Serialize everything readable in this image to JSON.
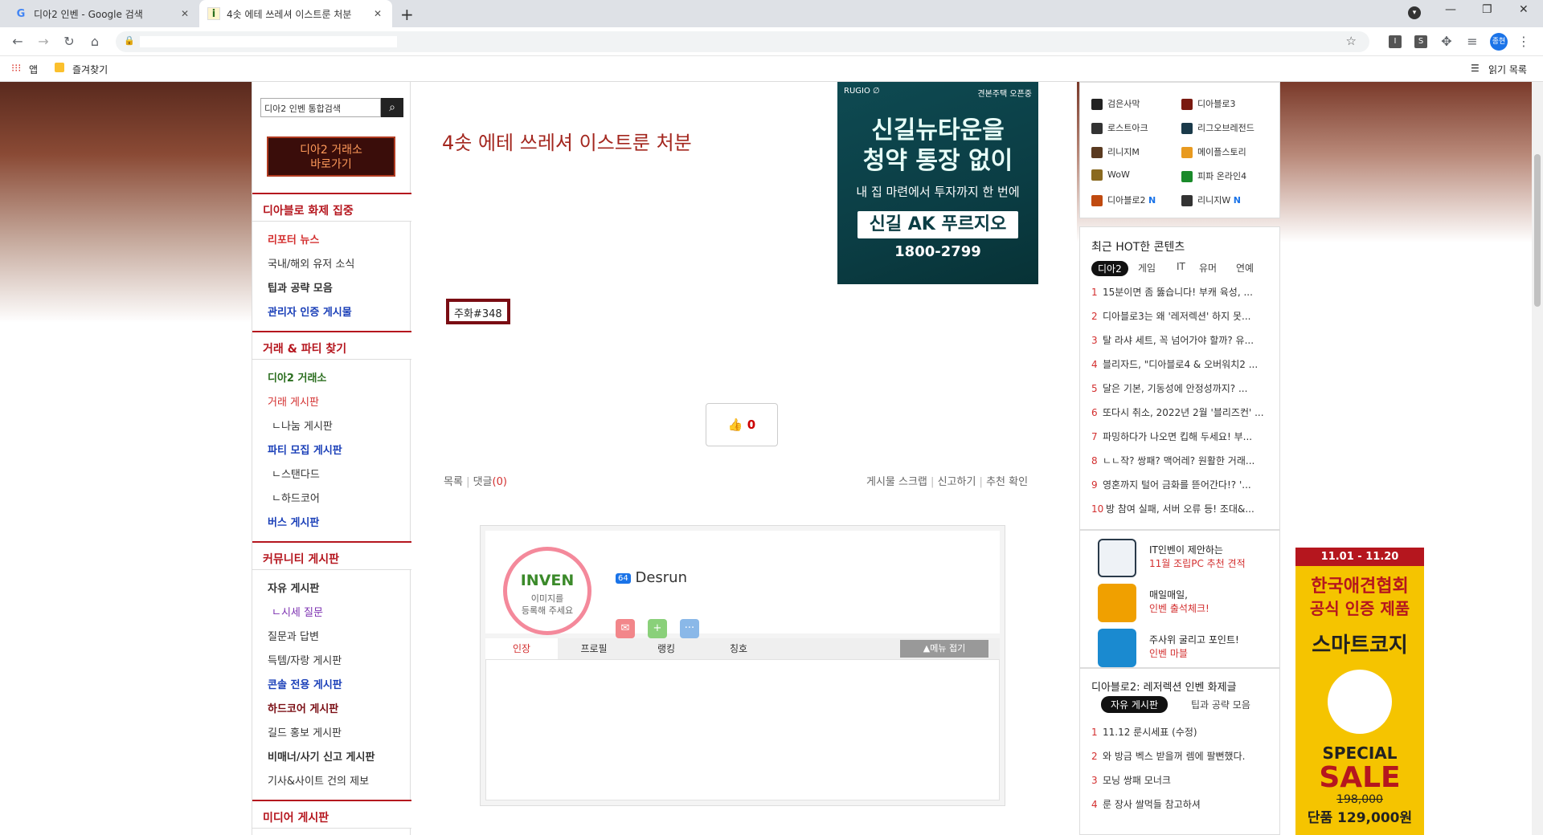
{
  "browser": {
    "tabs": [
      {
        "title": "디아2 인벤 - Google 검색",
        "favicon": "G"
      },
      {
        "title": "4솟 에테 쓰레셔 이스트룬 처분",
        "favicon": "i"
      }
    ],
    "new_tab": "+",
    "bookmarks": {
      "apps": "앱",
      "favorites": "즐겨찾기",
      "reading_list": "읽기 목록"
    },
    "profile_initials": "종현"
  },
  "sidebar": {
    "search_placeholder": "디아2 인벤 통합검색",
    "banner": {
      "line1": "디아2 거래소",
      "line2": "바로가기"
    },
    "sections": [
      {
        "title": "디아블로 화제 집중",
        "items": [
          "리포터 뉴스",
          "국내/해외 유저 소식",
          "팁과 공략 모음",
          "관리자 인증 게시물"
        ]
      },
      {
        "title": "거래 & 파티 찾기",
        "items": [
          "디아2 거래소",
          "거래 게시판",
          "ㄴ나눔 게시판",
          "파티 모집 게시판",
          "ㄴ스탠다드",
          "ㄴ하드코어",
          "버스 게시판"
        ]
      },
      {
        "title": "커뮤니티 게시판",
        "items": [
          "자유 게시판",
          "ㄴ시세 질문",
          "질문과 답변",
          "득템/자랑 게시판",
          "콘솔 전용 게시판",
          "하드코어 게시판",
          "길드 홍보 게시판",
          "비매너/사기 신고 게시판",
          "기사&사이트 건의 제보"
        ]
      },
      {
        "title": "미디어 게시판",
        "items": []
      }
    ]
  },
  "article": {
    "title": "4솟 에테 쓰레셔 이스트룬 처분",
    "tag": "주화#348",
    "likes": "0",
    "nav_left": {
      "list": "목록",
      "comments": "댓글",
      "comment_count": "(0)"
    },
    "nav_right": [
      "게시물 스크랩",
      "신고하기",
      "추천 확인"
    ]
  },
  "ad_top": {
    "brand": "RUGIO ∅",
    "corner": "견본주택 오픈중",
    "headline1": "신길뉴타운을",
    "headline2": "청약 통장 없이",
    "sub": "내 집 마련에서 투자까지 한 번에",
    "name": "신길 AK 푸르지오",
    "tel": "1800-2799"
  },
  "profile": {
    "logo": "INVEN",
    "avatar_text1": "이미지를",
    "avatar_text2": "등록해 주세요",
    "level": "64",
    "username": "Desrun",
    "tabs": [
      "인장",
      "프로필",
      "랭킹",
      "칭호"
    ],
    "fold": "▲메뉴 접기"
  },
  "games": [
    {
      "name": "검은사막",
      "color": "#222"
    },
    {
      "name": "디아블로3",
      "color": "#7a1a10"
    },
    {
      "name": "로스트아크",
      "color": "#333"
    },
    {
      "name": "리그오브레전드",
      "color": "#1a3a4a"
    },
    {
      "name": "리니지M",
      "color": "#5a3a20"
    },
    {
      "name": "메이플스토리",
      "color": "#e89a20"
    },
    {
      "name": "WoW",
      "color": "#8a6a20"
    },
    {
      "name": "피파 온라인4",
      "color": "#1a8a2a"
    },
    {
      "name": "디아블로2",
      "badge": "N",
      "color": "#c04a10"
    },
    {
      "name": "리니지W",
      "badge": "N",
      "color": "#333"
    }
  ],
  "hot": {
    "title": "최근 HOT한 콘텐츠",
    "tabs": [
      "디아2",
      "게임",
      "IT",
      "유머",
      "연예"
    ],
    "items": [
      "15분이면 좀 뚫습니다! 부캐 육성, ...",
      "디아블로3는 왜 '레저렉션' 하지 못...",
      "탈 라샤 세트, 꼭 넘어가야 할까? 유...",
      "블리자드, \"디아블로4 & 오버워치2 ...",
      "달은 기본, 기동성에 안정성까지? ...",
      "또다시 취소, 2022년 2월 '블리즈컨' ...",
      "파밍하다가 나오면 킵해 두세요! 부...",
      "ㄴㄴ작? 쌍패? 맥어레? 원활한 거래...",
      "영혼까지 털어 금화를 뜯어간다!? '...",
      "방 참여 실패, 서버 오류 등! 조대&..."
    ]
  },
  "promos": [
    {
      "line1": "IT인벤이 제안하는",
      "line2": "11월 조립PC 추천 견적",
      "icon": "monitor-icon",
      "color": "#2a3a4a"
    },
    {
      "line1": "매일매일,",
      "line2": "인벤 출석체크!",
      "icon": "calendar-icon",
      "color": "#f0a000"
    },
    {
      "line1": "주사위 굴리고 포인트!",
      "line2": "인벤 마블",
      "icon": "dice-icon",
      "color": "#1a8ad0"
    }
  ],
  "d2": {
    "title": "디아블로2: 레저렉션 인벤 화제글",
    "tabs": [
      "자유 게시판",
      "팁과 공략 모음"
    ],
    "items": [
      "11.12 룬시세표 (수정)",
      "와 방금 벡스 받을꺼 렘에 팔뻔했다.",
      "모닝 쌍패 모너크",
      "룬 장사 쌀먹들 참고하셔"
    ]
  },
  "ad_side": {
    "date": "11.01 - 11.20",
    "line1": "한국애견협회",
    "line2": "공식 인증 제품",
    "brand": "스마트코지",
    "special": "SPECIAL",
    "sale": "SALE",
    "old_price": "198,000",
    "price": "단품 129,000원"
  }
}
